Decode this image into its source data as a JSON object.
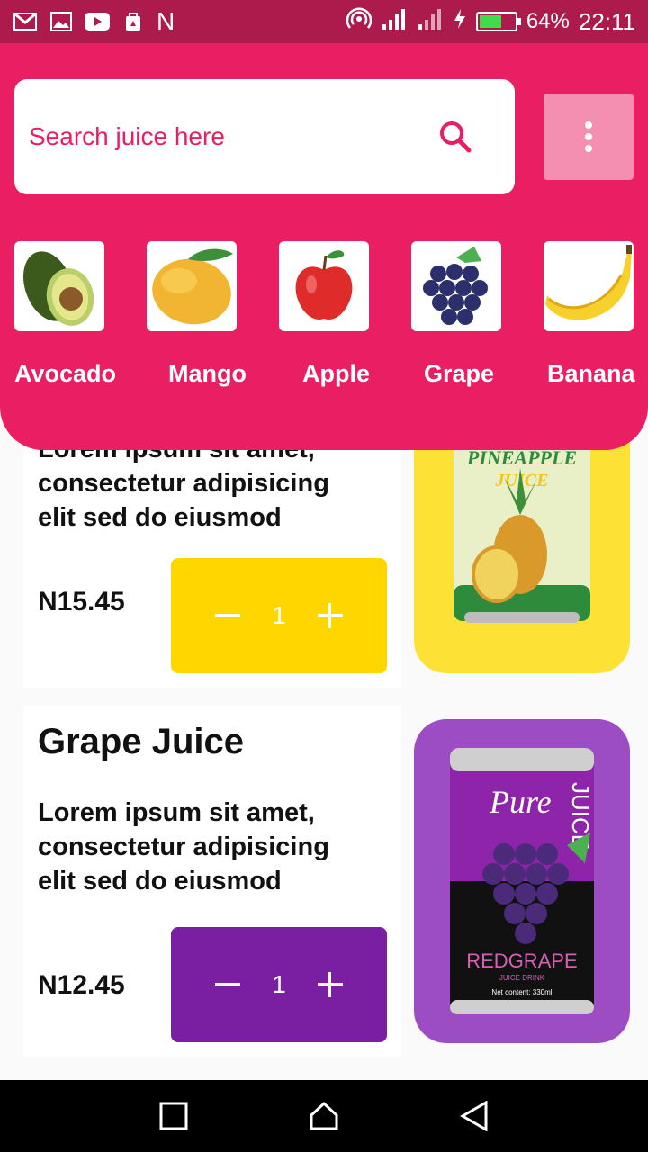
{
  "status_bar": {
    "battery": "64%",
    "time": "22:11",
    "carrier_letter": "N",
    "battery_level": 0.64
  },
  "search": {
    "placeholder": "Search juice here"
  },
  "categories": [
    {
      "label": "Avocado",
      "icon": "avocado-icon"
    },
    {
      "label": "Mango",
      "icon": "mango-icon"
    },
    {
      "label": "Apple",
      "icon": "apple-icon"
    },
    {
      "label": "Grape",
      "icon": "grape-icon"
    },
    {
      "label": "Banana",
      "icon": "banana-icon"
    }
  ],
  "products": [
    {
      "title": "",
      "description": "Lorem ipsum sit amet,\nconsectetur adipisicing\n elit sed do eiusmod",
      "price": "N15.45",
      "quantity": "1",
      "accent": "#ffd600",
      "can_bg": "#fde135",
      "can_text": "PINEAPPLE\nJUICE"
    },
    {
      "title": "Grape Juice",
      "description": "Lorem ipsum sit amet,\nconsectetur adipisicing\n elit sed do eiusmod",
      "price": "N12.45",
      "quantity": "1",
      "accent": "#7b1fa2",
      "can_bg": "#9c4dc4",
      "can_text": "REDGRAPE",
      "can_brand": "Pure",
      "can_side": "JUICE",
      "can_sub": "JUICE DRINK",
      "can_net": "Net content: 330ml"
    }
  ],
  "colors": {
    "header": "#e91e63",
    "status_bar": "#ad1a4c",
    "menu_button": "#f48fb1"
  }
}
